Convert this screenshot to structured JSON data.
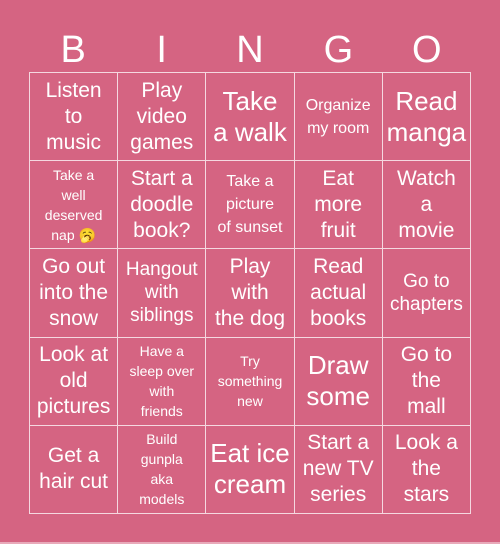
{
  "header": {
    "letters": [
      "B",
      "I",
      "N",
      "G",
      "O"
    ]
  },
  "colors": {
    "background": "#D56482",
    "text": "#FFFFFF",
    "grid_line": "#F2C9D4"
  },
  "cells": [
    {
      "text": "Listen\nto\nmusic",
      "size": "s-l"
    },
    {
      "text": "Play\nvideo\ngames",
      "size": "s-l"
    },
    {
      "text": "Take\na walk",
      "size": "s-xl"
    },
    {
      "text": "Organize\nmy room",
      "size": "s-s"
    },
    {
      "text": "Read\nmanga",
      "size": "s-xl"
    },
    {
      "text": "Take a\nwell\ndeserved\nnap 🥱",
      "size": "s-xs"
    },
    {
      "text": "Start a\ndoodle\nbook?",
      "size": "s-l"
    },
    {
      "text": "Take a\npicture\nof sunset",
      "size": "s-s"
    },
    {
      "text": "Eat\nmore\nfruit",
      "size": "s-l"
    },
    {
      "text": "Watch\na\nmovie",
      "size": "s-l"
    },
    {
      "text": "Go out\ninto the\nsnow",
      "size": "s-l"
    },
    {
      "text": "Hangout\nwith\nsiblings",
      "size": "s-m"
    },
    {
      "text": "Play\nwith\nthe dog",
      "size": "s-l"
    },
    {
      "text": "Read\nactual\nbooks",
      "size": "s-l"
    },
    {
      "text": "Go to\nchapters",
      "size": "s-m"
    },
    {
      "text": "Look at\nold\npictures",
      "size": "s-l"
    },
    {
      "text": "Have a\nsleep over\nwith\nfriends",
      "size": "s-xs"
    },
    {
      "text": "Try\nsomething\nnew",
      "size": "s-xs"
    },
    {
      "text": "Draw\nsome",
      "size": "s-xl"
    },
    {
      "text": "Go to\nthe\nmall",
      "size": "s-l"
    },
    {
      "text": "Get a\nhair cut",
      "size": "s-l"
    },
    {
      "text": "Build\ngunpla\naka\nmodels",
      "size": "s-xs"
    },
    {
      "text": "Eat ice\ncream",
      "size": "s-xl"
    },
    {
      "text": "Start a\nnew TV\nseries",
      "size": "s-l"
    },
    {
      "text": "Look a\nthe\nstars",
      "size": "s-l"
    }
  ]
}
